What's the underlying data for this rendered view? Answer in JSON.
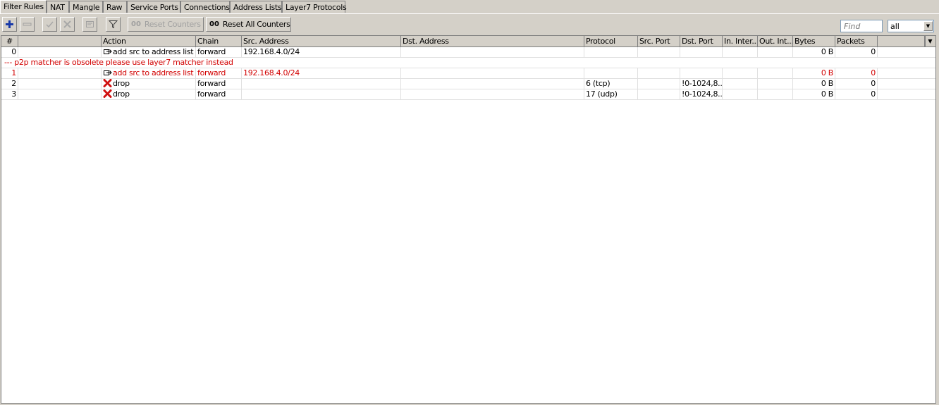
{
  "tabs": [
    {
      "label": "Filter Rules",
      "active": true
    },
    {
      "label": "NAT"
    },
    {
      "label": "Mangle"
    },
    {
      "label": "Raw"
    },
    {
      "label": "Service Ports"
    },
    {
      "label": "Connections"
    },
    {
      "label": "Address Lists"
    },
    {
      "label": "Layer7 Protocols"
    }
  ],
  "toolbar": {
    "add_icon": "plus-icon",
    "remove_icon": "minus-icon",
    "enable_icon": "check-icon",
    "disable_icon": "x-icon",
    "comment_icon": "note-icon",
    "filter_icon": "funnel-icon",
    "reset_counters_prefix": "00",
    "reset_counters_label": "Reset Counters",
    "reset_all_prefix": "00",
    "reset_all_label": "Reset All Counters",
    "find_placeholder": "Find",
    "filter_value": "all"
  },
  "table": {
    "columns": [
      "#",
      "",
      "Action",
      "Chain",
      "Src. Address",
      "Dst. Address",
      "Protocol",
      "Src. Port",
      "Dst. Port",
      "In. Inter...",
      "Out. Int...",
      "Bytes",
      "Packets"
    ],
    "rows": [
      {
        "num": "0",
        "action": "add src to address list",
        "action_icon": "add-to-list-icon",
        "chain": "forward",
        "src": "192.168.4.0/24",
        "dst": "",
        "protocol": "",
        "src_port": "",
        "dst_port": "",
        "in_iface": "",
        "out_iface": "",
        "bytes": "0 B",
        "packets": "0"
      },
      {
        "comment": "--- p2p matcher is obsolete please use layer7 matcher instead"
      },
      {
        "num": "1",
        "action": "add src to address list",
        "action_icon": "add-to-list-icon",
        "chain": "forward",
        "src": "192.168.4.0/24",
        "dst": "",
        "protocol": "",
        "src_port": "",
        "dst_port": "",
        "in_iface": "",
        "out_iface": "",
        "bytes": "0 B",
        "packets": "0",
        "invalid": true
      },
      {
        "num": "2",
        "action": "drop",
        "action_icon": "drop-x-icon",
        "chain": "forward",
        "src": "",
        "dst": "",
        "protocol": "6 (tcp)",
        "src_port": "",
        "dst_port": "!0-1024,8...",
        "in_iface": "",
        "out_iface": "",
        "bytes": "0 B",
        "packets": "0"
      },
      {
        "num": "3",
        "action": "drop",
        "action_icon": "drop-x-icon",
        "chain": "forward",
        "src": "",
        "dst": "",
        "protocol": "17 (udp)",
        "src_port": "",
        "dst_port": "!0-1024,8...",
        "in_iface": "",
        "out_iface": "",
        "bytes": "0 B",
        "packets": "0"
      }
    ]
  },
  "colors": {
    "invalid_text": "#d20000",
    "add_icon": "#1a3aa8",
    "drop_icon": "#d01010"
  }
}
